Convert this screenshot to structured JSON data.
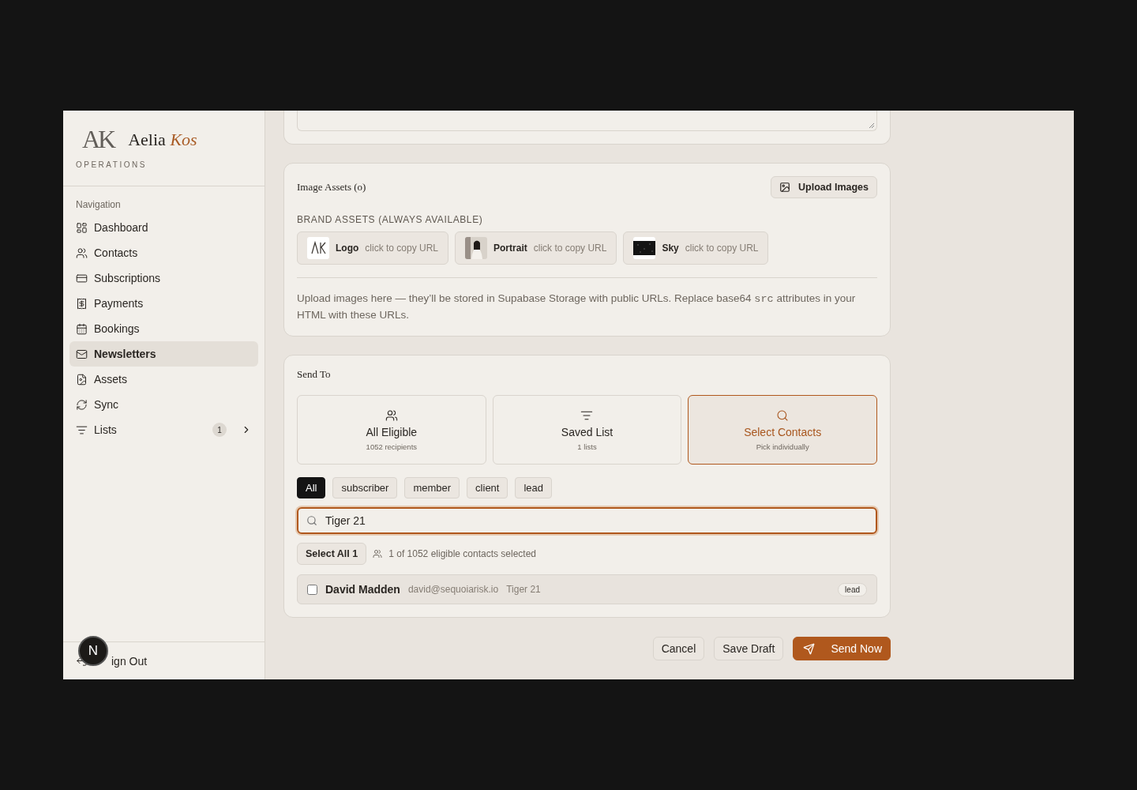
{
  "brand": {
    "monogram": "AK",
    "name_first": "Aelia",
    "name_accent": "Kos",
    "subtitle": "OPERATIONS"
  },
  "nav": {
    "heading": "Navigation",
    "items": [
      {
        "label": "Dashboard",
        "kind": "dashboard",
        "selected": false,
        "expandable": false
      },
      {
        "label": "Contacts",
        "kind": "users",
        "selected": false,
        "expandable": false
      },
      {
        "label": "Subscriptions",
        "kind": "card",
        "selected": false,
        "expandable": false
      },
      {
        "label": "Payments",
        "kind": "receipt",
        "selected": false,
        "expandable": false
      },
      {
        "label": "Bookings",
        "kind": "calendar",
        "selected": false,
        "expandable": false
      },
      {
        "label": "Newsletters",
        "kind": "mail",
        "selected": true,
        "expandable": false
      },
      {
        "label": "Assets",
        "kind": "file-image",
        "selected": false,
        "expandable": false
      },
      {
        "label": "Sync",
        "kind": "sync",
        "selected": false,
        "expandable": false
      },
      {
        "label": "Lists",
        "kind": "filter",
        "selected": false,
        "expandable": true,
        "badge": "1"
      }
    ]
  },
  "sign_out": {
    "label": "ign Out"
  },
  "dev_badge": {
    "letter": "N"
  },
  "image_assets": {
    "title": "Image Assets (o)",
    "upload_button": "Upload Images",
    "brand_heading": "BRAND ASSETS (ALWAYS AVAILABLE)",
    "assets": [
      {
        "name": "Logo",
        "hint": "click to copy URL",
        "kind": "logo"
      },
      {
        "name": "Portrait",
        "hint": "click to copy URL",
        "kind": "portrait"
      },
      {
        "name": "Sky",
        "hint": "click to copy URL",
        "kind": "sky"
      }
    ],
    "note_before": "Upload images here — they’ll be stored in Supabase Storage with public URLs. Replace base64 ",
    "note_code": "src",
    "note_after": " attributes in your HTML with these URLs."
  },
  "send_to": {
    "title": "Send To",
    "options": [
      {
        "title": "All Eligible",
        "subtitle": "1052 recipients",
        "kind": "users",
        "selected": false
      },
      {
        "title": "Saved List",
        "subtitle": "1 lists",
        "kind": "filter",
        "selected": false
      },
      {
        "title": "Select Contacts",
        "subtitle": "Pick individually",
        "kind": "search",
        "selected": true
      }
    ],
    "filters": [
      {
        "label": "All",
        "selected": true
      },
      {
        "label": "subscriber",
        "selected": false
      },
      {
        "label": "member",
        "selected": false
      },
      {
        "label": "client",
        "selected": false
      },
      {
        "label": "lead",
        "selected": false
      }
    ],
    "search": {
      "value": "Tiger 21"
    },
    "select_all_button": "Select All 1",
    "selection_summary": "1 of 1052 eligible contacts selected",
    "contacts": [
      {
        "name": "David Madden",
        "email": "david@sequoiarisk.io",
        "company": "Tiger 21",
        "tag": "lead",
        "checked": false
      }
    ]
  },
  "actions": [
    {
      "label": "Cancel",
      "kind": "secondary"
    },
    {
      "label": "Save Draft",
      "kind": "secondary"
    },
    {
      "label": "Send Now",
      "kind": "primary"
    }
  ]
}
